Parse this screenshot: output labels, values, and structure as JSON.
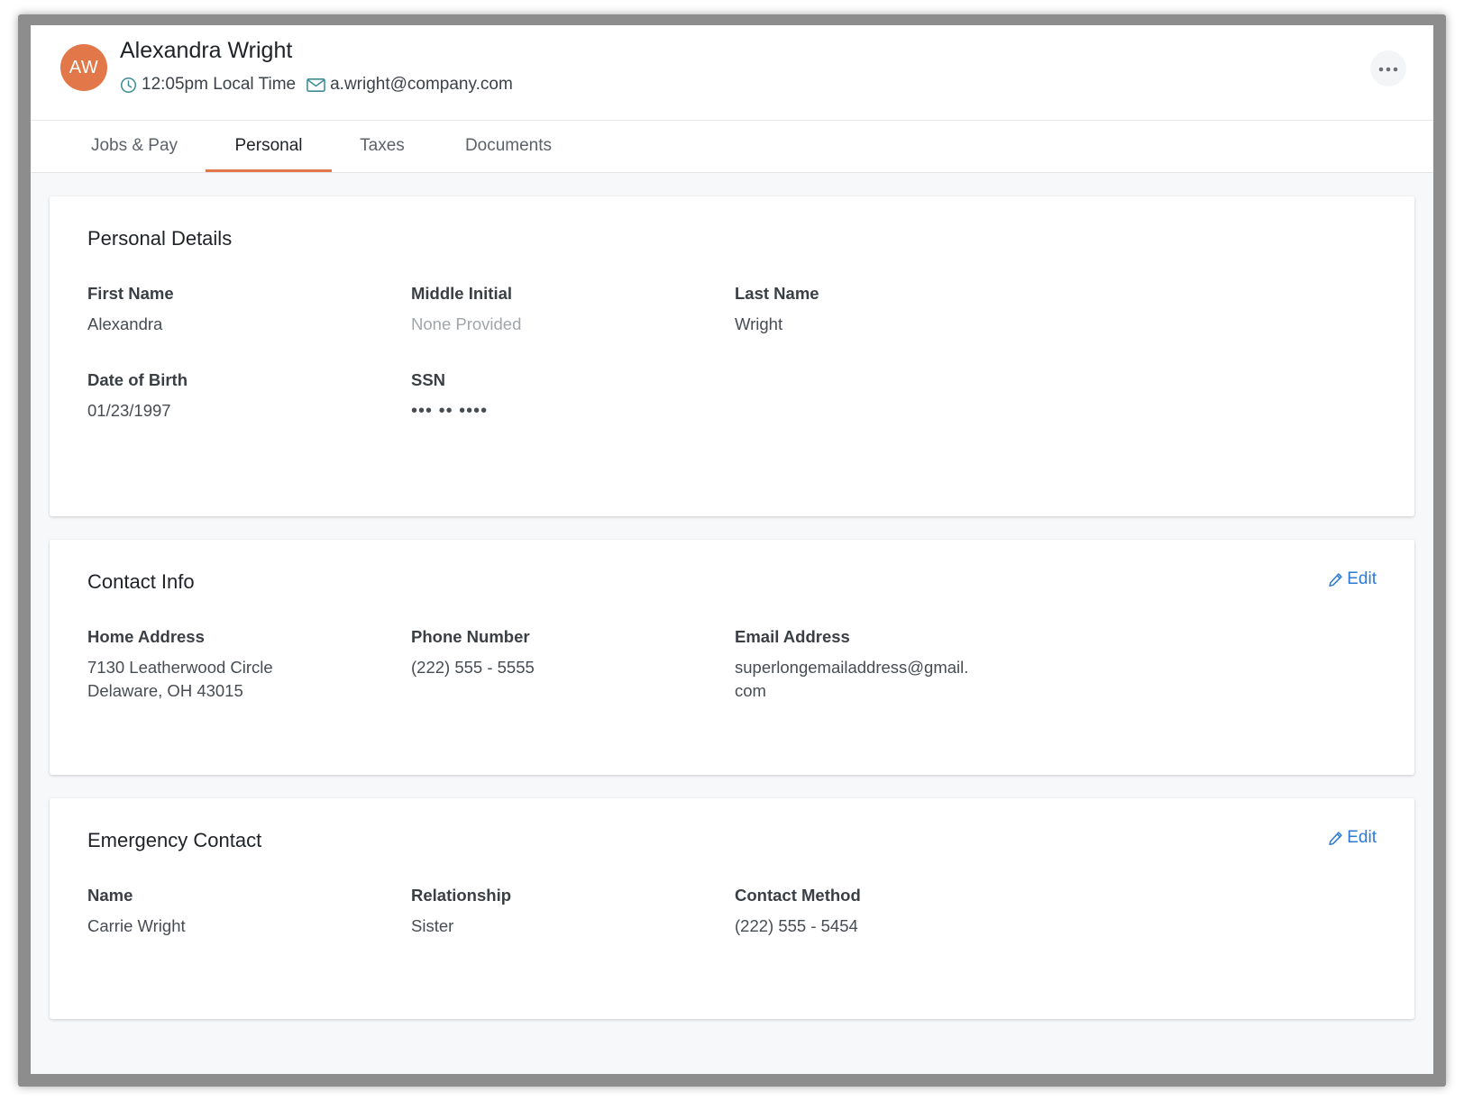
{
  "header": {
    "avatar_initials": "AW",
    "avatar_color": "#e2784a",
    "name": "Alexandra Wright",
    "local_time": "12:05pm Local Time",
    "email": "a.wright@company.com",
    "time_icon": "clock-icon",
    "email_icon": "envelope-icon",
    "more_icon": "more-options-icon"
  },
  "tabs": [
    {
      "label": "Jobs & Pay",
      "active": false
    },
    {
      "label": "Personal",
      "active": true
    },
    {
      "label": "Taxes",
      "active": false
    },
    {
      "label": "Documents",
      "active": false
    }
  ],
  "accent_color": "#e2784a",
  "link_color": "#2b7bd6",
  "personal_details": {
    "title": "Personal Details",
    "fields": [
      {
        "label": "First Name",
        "value": "Alexandra"
      },
      {
        "label": "Middle Initial",
        "value": "None Provided"
      },
      {
        "label": "Last Name",
        "value": "Wright"
      },
      {
        "label": "Date of Birth",
        "value": "01/23/1997"
      },
      {
        "label": "SSN",
        "value": "••• •• ••••"
      }
    ]
  },
  "contact_info": {
    "title": "Contact Info",
    "edit_label": "Edit",
    "fields": [
      {
        "label": "Home Address",
        "value": "7130 Leatherwood Circle\nDelaware, OH 43015"
      },
      {
        "label": "Phone Number",
        "value": "(222) 555 - 5555"
      },
      {
        "label": "Email Address",
        "value": "superlongemailaddress@gmail.\ncom"
      }
    ]
  },
  "emergency_contact": {
    "title": "Emergency Contact",
    "edit_label": "Edit",
    "fields": [
      {
        "label": "Name",
        "value": "Carrie Wright"
      },
      {
        "label": "Relationship",
        "value": "Sister"
      },
      {
        "label": "Contact Method",
        "value": "(222) 555 - 5454"
      }
    ]
  }
}
